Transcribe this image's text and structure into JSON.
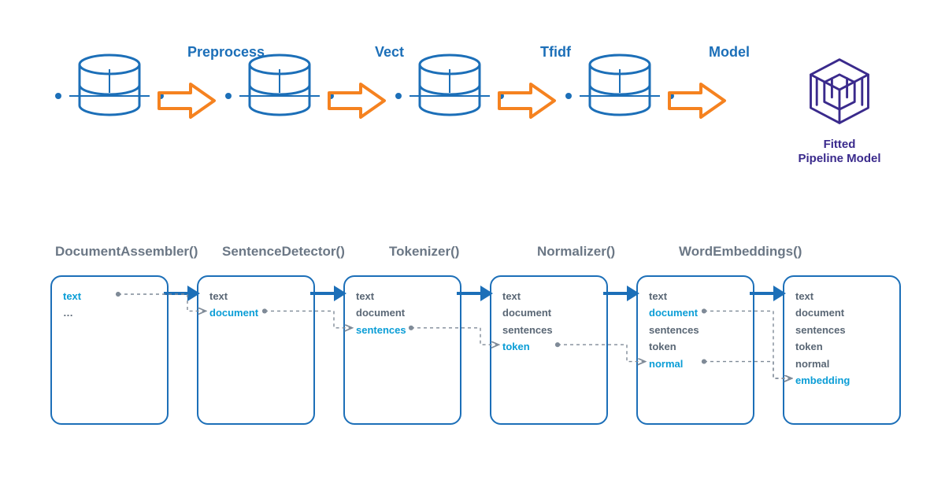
{
  "colors": {
    "blue": "#1c6fb8",
    "cyan": "#0a9dd6",
    "orange": "#f58220",
    "purple": "#3a2a8c",
    "gray": "#6b7785"
  },
  "pipeline": {
    "stages": [
      "Preprocess",
      "Vect",
      "Tfidf",
      "Model"
    ],
    "final_label_line1": "Fitted",
    "final_label_line2": "Pipeline Model"
  },
  "annotators": {
    "steps": [
      "DocumentAssembler()",
      "SentenceDetector()",
      "Tokenizer()",
      "Normalizer()",
      "WordEmbeddings()"
    ],
    "cards": [
      {
        "items": [
          "text",
          "…"
        ],
        "active": [
          0
        ],
        "out_src": 0
      },
      {
        "items": [
          "text",
          "document"
        ],
        "active": [
          1
        ],
        "out_src": 1
      },
      {
        "items": [
          "text",
          "document",
          "sentences"
        ],
        "active": [
          2
        ],
        "out_src": 2
      },
      {
        "items": [
          "text",
          "document",
          "sentences",
          "token"
        ],
        "active": [
          3
        ],
        "out_src": 3
      },
      {
        "items": [
          "text",
          "document",
          "sentences",
          "token",
          "normal"
        ],
        "active": [
          1,
          4
        ],
        "out_src_multi": [
          1,
          4
        ]
      },
      {
        "items": [
          "text",
          "document",
          "sentences",
          "token",
          "normal",
          "embedding"
        ],
        "active": [
          5
        ]
      }
    ]
  }
}
